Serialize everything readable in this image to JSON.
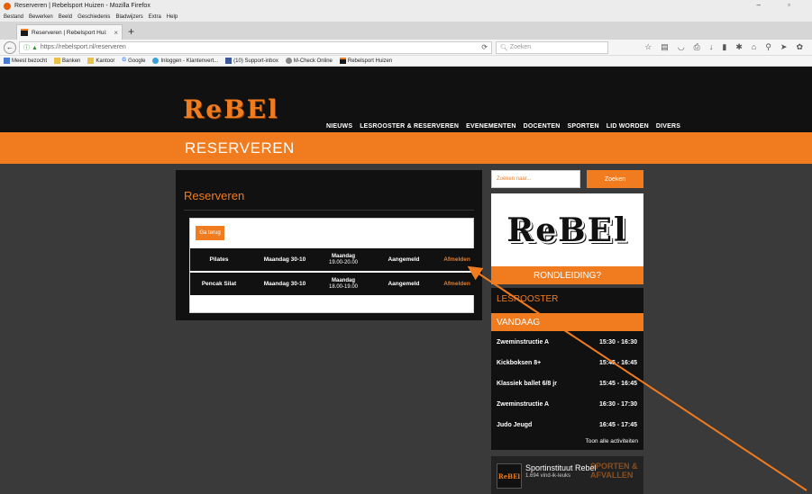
{
  "browser": {
    "window_title": "Reserveren | Rebelsport Huizen - Mozilla Firefox",
    "window_controls": "–  ▫",
    "menu": [
      "Bestand",
      "Bewerken",
      "Beeld",
      "Geschiedenis",
      "Bladwijzers",
      "Extra",
      "Help"
    ],
    "tab_title": "Reserveren | Rebelsport Hui:",
    "tab_close": "×",
    "new_tab": "+",
    "url": "https://rebelsport.nl/reserveren",
    "search_placeholder": "Zoeken",
    "bookmarks": [
      {
        "label": "Meest bezocht",
        "icon": "star-icon"
      },
      {
        "label": "Banken",
        "icon": "folder-icon"
      },
      {
        "label": "Kantoor",
        "icon": "folder-icon"
      },
      {
        "label": "Google",
        "icon": "google-icon"
      },
      {
        "label": "Inloggen - Klantenvert...",
        "icon": "globe-icon"
      },
      {
        "label": "(10) Support-inbox",
        "icon": "facebook-icon"
      },
      {
        "label": "M-Check Online",
        "icon": "globe-icon"
      },
      {
        "label": "Rebelsport Huizen",
        "icon": "rebel-icon"
      }
    ]
  },
  "site": {
    "logo": "ReBEl",
    "nav": [
      "NIEUWS",
      "LESROOSTER & RESERVEREN",
      "EVENEMENTEN",
      "DOCENTEN",
      "SPORTEN",
      "LID WORDEN",
      "DIVERS"
    ],
    "page_heading": "RESERVEREN"
  },
  "reserveren": {
    "title": "Reserveren",
    "back_label": "Ga terug",
    "rows": [
      {
        "sport": "Pilates",
        "date": "Maandag 30-10",
        "day": "Maandag",
        "time": "19.00-20.00",
        "status": "Aangemeld",
        "action": "Afmelden"
      },
      {
        "sport": "Pencak Silat",
        "date": "Maandag 30-10",
        "day": "Maandag",
        "time": "18.00-19.00",
        "status": "Aangemeld",
        "action": "Afmelden"
      }
    ]
  },
  "sidebar": {
    "search_placeholder": "Zoeken naar...",
    "search_button": "Zoeken",
    "logo": "ReBEl",
    "rondleiding": "RONDLEIDING?",
    "lesrooster_title": "LESROOSTER",
    "vandaag": "VANDAAG",
    "schedule": [
      {
        "name": "Zweminstructie A",
        "time": "15:30 - 16:30"
      },
      {
        "name": "Kickboksen 8+",
        "time": "15:45 - 16:45"
      },
      {
        "name": "Klassiek ballet 6/8 jr",
        "time": "15:45 - 16:45"
      },
      {
        "name": "Zweminstructie A",
        "time": "16:30 - 17:30"
      },
      {
        "name": "Judo Jeugd",
        "time": "16:45 - 17:45"
      }
    ],
    "all_activities": "Toon alle activiteiten",
    "fb_name": "Sportinstituut Rebel",
    "fb_likes": "1.694 vind-ik-leuks",
    "fb_thumb": "ReBEl",
    "fb_promo": "SPORTEN & AFVALLEN"
  },
  "colors": {
    "accent": "#f07c1f",
    "dark": "#111111",
    "page_bg": "#3a3a3a"
  }
}
